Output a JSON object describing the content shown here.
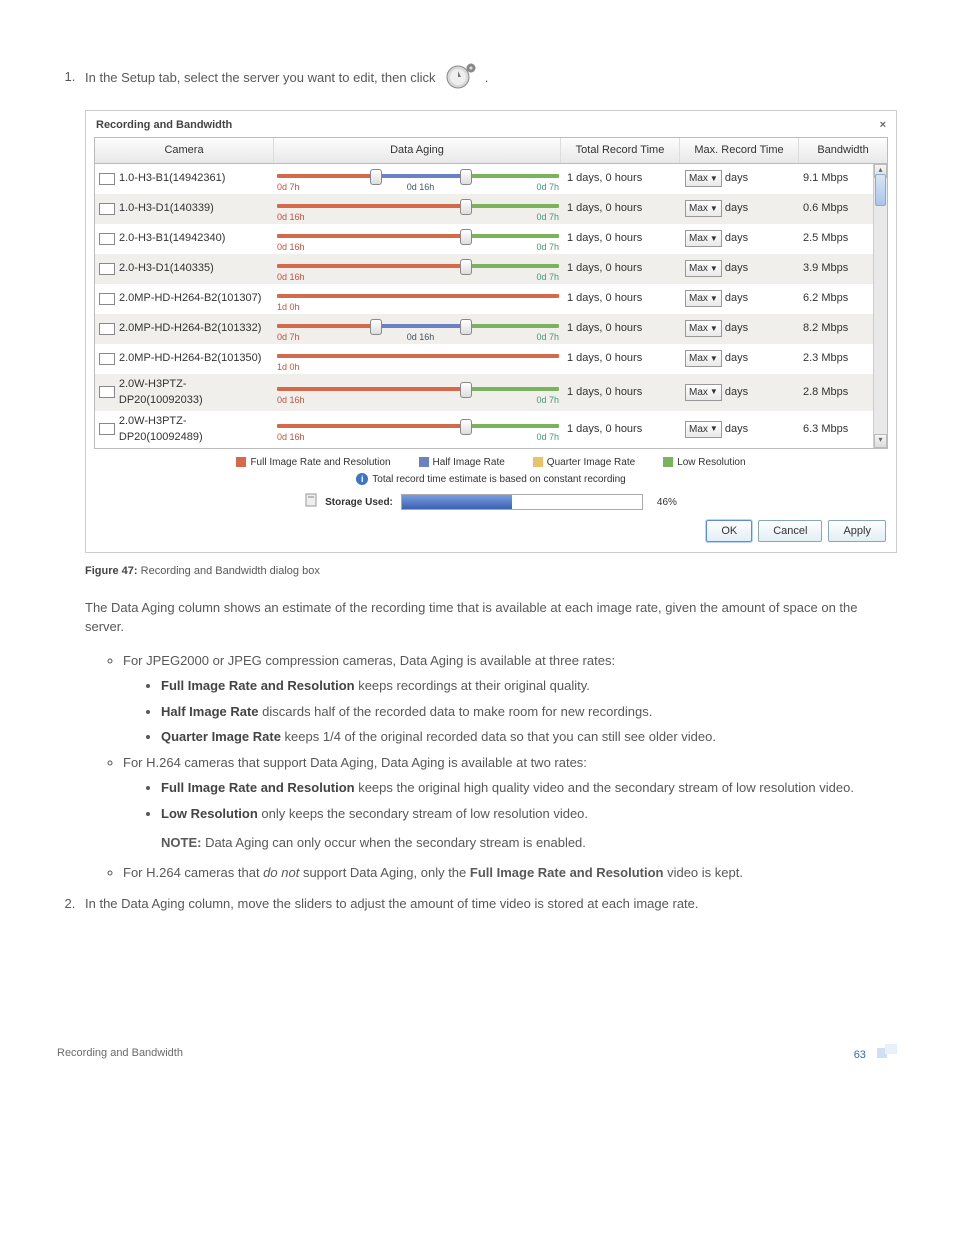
{
  "step1_pre": "In the Setup tab, select the server you want to edit, then click ",
  "step1_post": ".",
  "dialog": {
    "title": "Recording and Bandwidth",
    "close": "×",
    "headers": {
      "camera": "Camera",
      "aging": "Data Aging",
      "total": "Total Record Time",
      "max": "Max. Record Time",
      "bw": "Bandwidth"
    },
    "rows": [
      {
        "name": "1.0-H3-B1(14942361)",
        "type": "triple",
        "ticks": [
          "0d 7h",
          "0d 16h",
          "0d 7h"
        ],
        "trt": "1 days, 0 hours",
        "max": "Max",
        "unit": "days",
        "bw": "9.1 Mbps"
      },
      {
        "name": "1.0-H3-D1(140339)",
        "type": "double",
        "ticks": [
          "0d 16h",
          "",
          "0d 7h"
        ],
        "trt": "1 days, 0 hours",
        "max": "Max",
        "unit": "days",
        "bw": "0.6 Mbps"
      },
      {
        "name": "2.0-H3-B1(14942340)",
        "type": "double",
        "ticks": [
          "0d 16h",
          "",
          "0d 7h"
        ],
        "trt": "1 days, 0 hours",
        "max": "Max",
        "unit": "days",
        "bw": "2.5 Mbps"
      },
      {
        "name": "2.0-H3-D1(140335)",
        "type": "double",
        "ticks": [
          "0d 16h",
          "",
          "0d 7h"
        ],
        "trt": "1 days, 0 hours",
        "max": "Max",
        "unit": "days",
        "bw": "3.9 Mbps"
      },
      {
        "name": "2.0MP-HD-H264-B2(101307)",
        "type": "single",
        "ticks": [
          "1d 0h",
          "",
          ""
        ],
        "trt": "1 days, 0 hours",
        "max": "Max",
        "unit": "days",
        "bw": "6.2 Mbps"
      },
      {
        "name": "2.0MP-HD-H264-B2(101332)",
        "type": "triple",
        "ticks": [
          "0d 7h",
          "0d 16h",
          "0d 7h"
        ],
        "trt": "1 days, 0 hours",
        "max": "Max",
        "unit": "days",
        "bw": "8.2 Mbps"
      },
      {
        "name": "2.0MP-HD-H264-B2(101350)",
        "type": "single",
        "ticks": [
          "1d 0h",
          "",
          ""
        ],
        "trt": "1 days, 0 hours",
        "max": "Max",
        "unit": "days",
        "bw": "2.3 Mbps"
      },
      {
        "name": "2.0W-H3PTZ-DP20(10092033)",
        "type": "double",
        "ticks": [
          "0d 16h",
          "",
          "0d 7h"
        ],
        "trt": "1 days, 0 hours",
        "max": "Max",
        "unit": "days",
        "bw": "2.8 Mbps"
      },
      {
        "name": "2.0W-H3PTZ-DP20(10092489)",
        "type": "double",
        "ticks": [
          "0d 16h",
          "",
          "0d 7h"
        ],
        "trt": "1 days, 0 hours",
        "max": "Max",
        "unit": "days",
        "bw": "6.3 Mbps"
      }
    ],
    "legend": {
      "full": "Full Image Rate and Resolution",
      "half": "Half Image Rate",
      "quarter": "Quarter Image Rate",
      "low": "Low Resolution"
    },
    "estimate": "Total record time estimate is based on constant recording",
    "storage_label": "Storage Used:",
    "storage_pct": "46%",
    "buttons": {
      "ok": "OK",
      "cancel": "Cancel",
      "apply": "Apply"
    }
  },
  "caption_prefix": "Figure 47:",
  "caption_text": " Recording and Bandwidth dialog box",
  "para1": "The Data Aging column shows an estimate of the recording time that is available at each image rate, given the amount of space on the server.",
  "bullet_jpeg": "For JPEG2000 or JPEG compression cameras, Data Aging is available at three rates:",
  "jpeg_items": [
    {
      "b": "Full Image Rate and Resolution",
      "t": " keeps recordings at their original quality."
    },
    {
      "b": "Half Image Rate",
      "t": " discards half of the recorded data to make room for new recordings."
    },
    {
      "b": "Quarter Image Rate",
      "t": " keeps 1/4 of the original recorded data so that you can still see older video."
    }
  ],
  "bullet_h264a": "For H.264 cameras that support Data Aging, Data Aging is available at two rates:",
  "h264a_items": [
    {
      "b": "Full Image Rate and Resolution",
      "t": " keeps the original high quality video and the secondary stream of low resolution video."
    },
    {
      "b": "Low Resolution",
      "t": " only keeps the secondary stream of low resolution video."
    }
  ],
  "note_b": "NOTE:",
  "note_t": " Data Aging can only occur when the secondary stream is enabled.",
  "bullet_h264b_pre": "For H.264 cameras that ",
  "bullet_h264b_em": "do not",
  "bullet_h264b_mid": " support Data Aging, only the ",
  "bullet_h264b_b": "Full Image Rate and Resolution",
  "bullet_h264b_post": " video is kept.",
  "step2": "In the Data Aging column, move the sliders to adjust the amount of time video is stored at each image rate.",
  "footer_title": "Recording and Bandwidth",
  "footer_page": "63"
}
